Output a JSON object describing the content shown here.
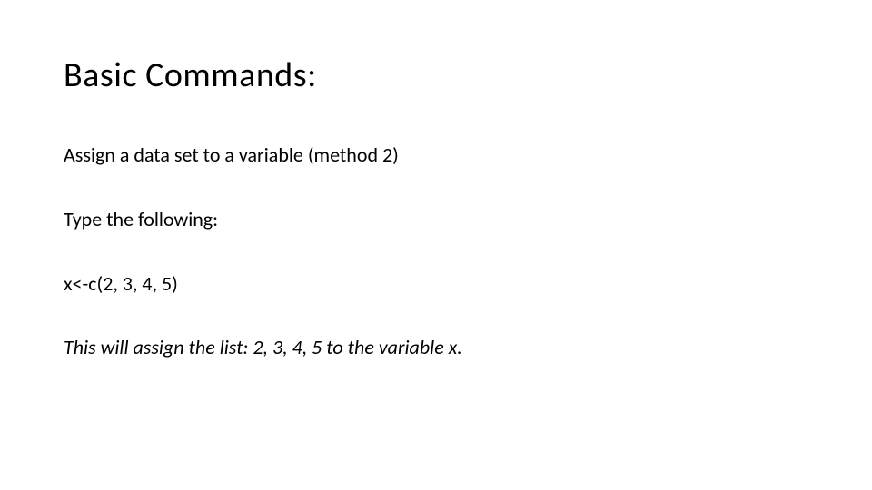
{
  "slide": {
    "title": "Basic Commands:",
    "line1": "Assign a data set to a variable (method 2)",
    "line2": "Type the following:",
    "code": "x<-c(2, 3, 4, 5)",
    "explanation": "This will assign the list: 2, 3, 4, 5 to the variable x."
  }
}
